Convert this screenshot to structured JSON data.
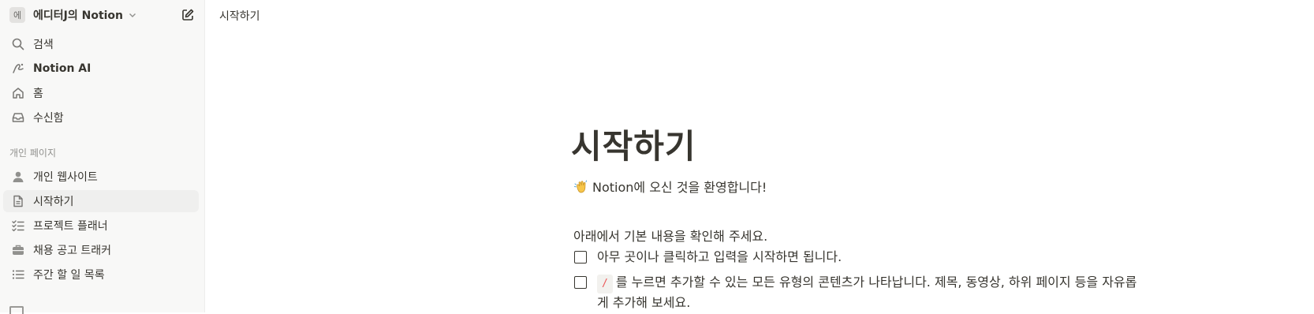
{
  "workspace": {
    "avatar": "에",
    "name": "에디터J의 Notion"
  },
  "topbar": {
    "breadcrumb": "시작하기"
  },
  "sidebar": {
    "nav": [
      {
        "label": "검색",
        "icon": "search-icon"
      },
      {
        "label": "Notion AI",
        "icon": "notion-ai-icon"
      },
      {
        "label": "홈",
        "icon": "home-icon"
      },
      {
        "label": "수신함",
        "icon": "inbox-icon"
      }
    ],
    "section_title": "개인 페이지",
    "pages": [
      {
        "label": "개인 웹사이트",
        "icon": "person-icon"
      },
      {
        "label": "시작하기",
        "icon": "page-icon",
        "active": true
      },
      {
        "label": "프로젝트 플래너",
        "icon": "checklist-icon"
      },
      {
        "label": "채용 공고 트래커",
        "icon": "briefcase-icon"
      },
      {
        "label": "주간 할 일 목록",
        "icon": "list-icon"
      }
    ]
  },
  "page": {
    "title": "시작하기",
    "welcome": "Notion에 오신 것을 환영합니다!",
    "intro": "아래에서 기본 내용을 확인해 주세요.",
    "todos": [
      {
        "text": "아무 곳이나 클릭하고 입력을 시작하면 됩니다."
      },
      {
        "code": "/",
        "text": "를 누르면 추가할 수 있는 모든 유형의 콘텐츠가 나타납니다. 제목, 동영상, 하위 페이지 등을 자유롭게 추가해 보세요."
      }
    ]
  },
  "colors": {
    "sidebar_bg": "#f8f8f7",
    "active_bg": "#efefee",
    "text": "#37352f",
    "muted": "#91918e",
    "code_red": "#eb5757"
  }
}
